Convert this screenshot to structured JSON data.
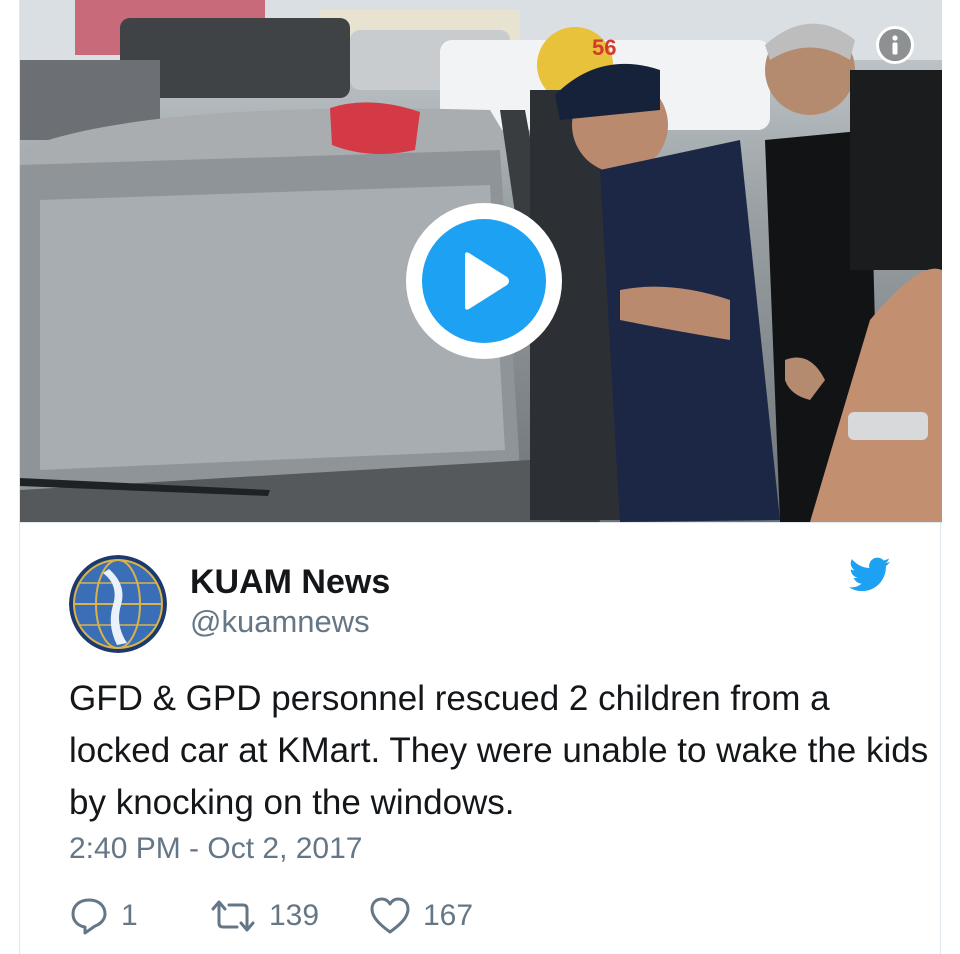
{
  "media": {
    "play_icon": "play-icon",
    "info_icon": "info-icon",
    "jersey_number": "56"
  },
  "tweet": {
    "display_name": "KUAM News",
    "handle": "@kuamnews",
    "text": "GFD & GPD personnel rescued 2 children from a locked car at KMart. They were unable to wake the kids by knocking on the windows.",
    "timestamp": "2:40 PM - Oct 2, 2017",
    "brand_icon": "twitter-bird-icon",
    "brand_color": "#1da1f2"
  },
  "actions": {
    "reply_count": "1",
    "retweet_count": "139",
    "like_count": "167"
  },
  "colors": {
    "text_primary": "#14171a",
    "text_secondary": "#657786",
    "accent": "#1da1f2"
  }
}
